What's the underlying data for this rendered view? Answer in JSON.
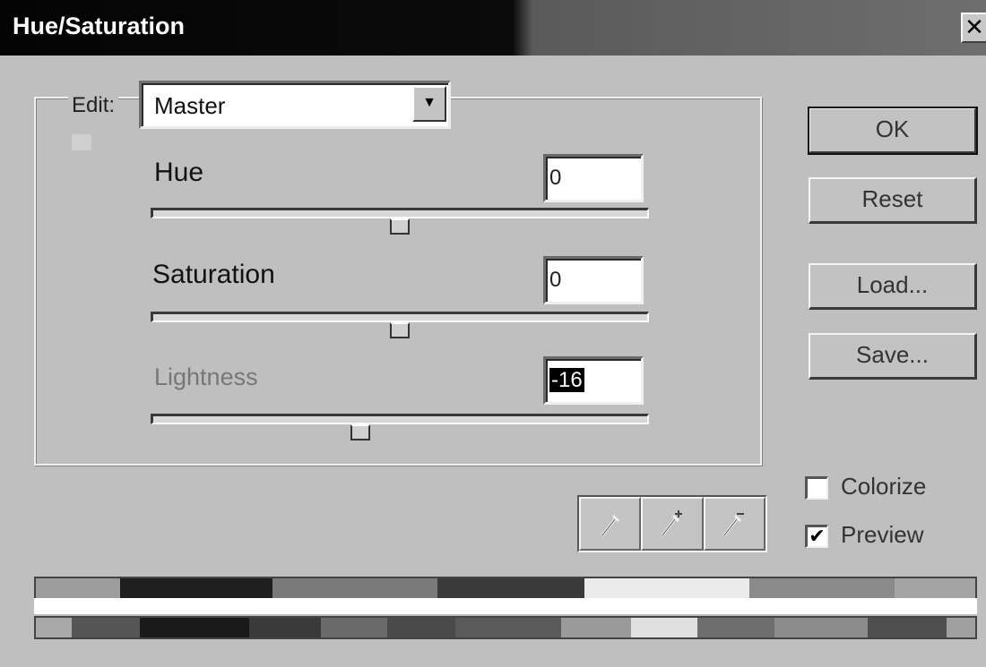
{
  "window": {
    "title": "Hue/Saturation",
    "close_icon": "close-icon"
  },
  "edit": {
    "label": "Edit:",
    "value": "Master"
  },
  "sliders": [
    {
      "label": "Hue",
      "value": "0",
      "level": 0.5
    },
    {
      "label": "Saturation",
      "value": "0",
      "level": 0.5
    },
    {
      "label": "Lightness",
      "value": "-16",
      "level": 0.42
    }
  ],
  "buttons": {
    "ok": "OK",
    "reset": "Reset",
    "load": "Load...",
    "save": "Save..."
  },
  "options": {
    "colorize": {
      "label": "Colorize",
      "checked": false
    },
    "preview": {
      "label": "Preview",
      "checked": true
    }
  },
  "eyedroppers": [
    "eyedropper-icon",
    "eyedropper-plus-icon",
    "eyedropper-minus-icon"
  ],
  "color_bars": {
    "top": [
      "#9c9c9c",
      "#1e1e1e",
      "#7a7a7a",
      "#3a3a3a",
      "#ebebeb",
      "#8a8a8a",
      "#a4a4a4"
    ],
    "bottom": [
      "#a8a8a8",
      "#555555",
      "#1a1a1a",
      "#3a3a3a",
      "#6a6a6a",
      "#4a4a4a",
      "#5a5a5a",
      "#9a9a9a",
      "#e0e0e0",
      "#6e6e6e",
      "#8c8c8c",
      "#4e4e4e",
      "#a0a0a0"
    ]
  }
}
